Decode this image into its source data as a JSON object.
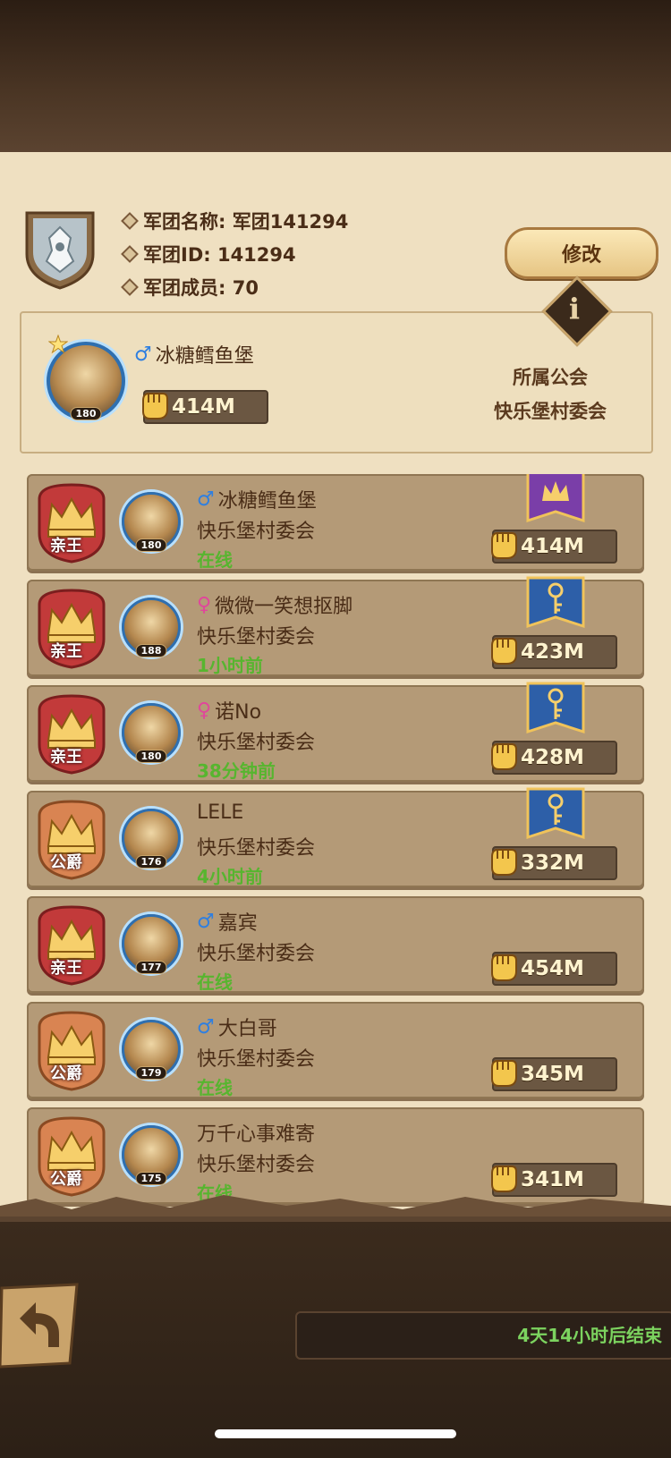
{
  "legion": {
    "name_line": "军团名称: 军团141294",
    "id_line": "军团ID: 141294",
    "members_line": "军团成员: 70",
    "edit_label": "修改",
    "info_glyph": "i"
  },
  "leader": {
    "gender": "♂",
    "name": "冰糖鳕鱼堡",
    "level": "180",
    "power": "414M",
    "guild_label": "所属公会",
    "guild_name": "快乐堡村委会"
  },
  "members": [
    {
      "rank": "亲王",
      "gender": "♂",
      "name": "冰糖鳕鱼堡",
      "level": "180",
      "guild": "快乐堡村委会",
      "status": "在线",
      "power": "414M",
      "banner": "crown-purple"
    },
    {
      "rank": "亲王",
      "gender": "♀",
      "name": "微微一笑想抠脚",
      "level": "188",
      "guild": "快乐堡村委会",
      "status": "1小时前",
      "power": "423M",
      "banner": "key-blue"
    },
    {
      "rank": "亲王",
      "gender": "♀",
      "name": "诺No",
      "level": "180",
      "guild": "快乐堡村委会",
      "status": "38分钟前",
      "power": "428M",
      "banner": "key-blue"
    },
    {
      "rank": "公爵",
      "gender": "",
      "name": "LELE",
      "level": "176",
      "guild": "快乐堡村委会",
      "status": "4小时前",
      "power": "332M",
      "banner": "key-blue"
    },
    {
      "rank": "亲王",
      "gender": "♂",
      "name": "嘉宾",
      "level": "177",
      "guild": "快乐堡村委会",
      "status": "在线",
      "power": "454M",
      "banner": ""
    },
    {
      "rank": "公爵",
      "gender": "♂",
      "name": "大白哥",
      "level": "179",
      "guild": "快乐堡村委会",
      "status": "在线",
      "power": "345M",
      "banner": ""
    },
    {
      "rank": "公爵",
      "gender": "",
      "name": "万千心事难寄",
      "level": "175",
      "guild": "快乐堡村委会",
      "status": "在线",
      "power": "341M",
      "banner": ""
    }
  ],
  "footer": {
    "timer": "4天14小时后结束"
  },
  "colors": {
    "panel": "#efe0c1",
    "online_green": "#57b52f",
    "male_blue": "#2f7fe0",
    "female_pink": "#e0479b"
  }
}
